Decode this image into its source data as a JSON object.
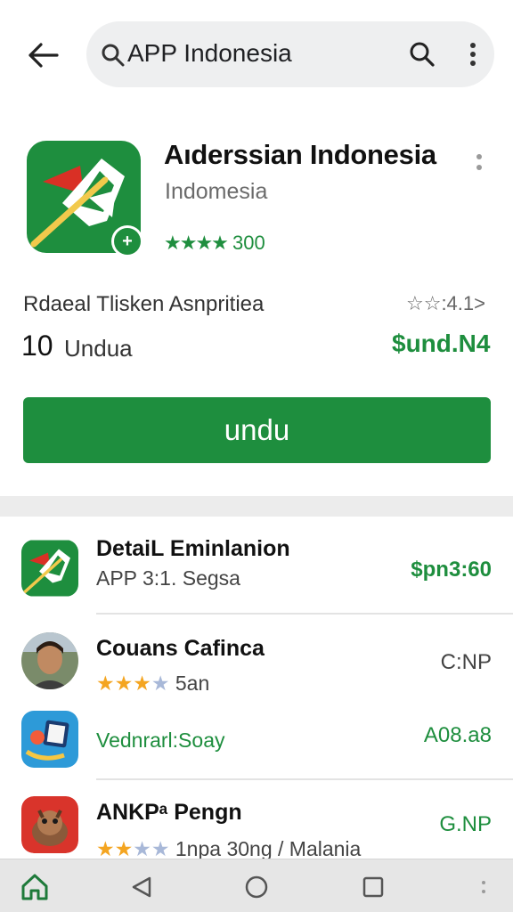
{
  "search": {
    "query": "APP Indonesia"
  },
  "app": {
    "title": "Aıderssian Indonesia",
    "developer": "Indomesia",
    "stars": "★★★★",
    "rating_text": "300",
    "meta_label": "Rdaeal Tlisken Asnpritiea",
    "meta_rating": "☆☆:4.1>",
    "count": "10",
    "count_label": "Undua",
    "price": "$und.N4",
    "install_label": "undu"
  },
  "list": [
    {
      "title": "DetaiL Eminlanion",
      "sub": "APP 3:1. Segsa",
      "right": "$pn3:60",
      "right_style": "green"
    },
    {
      "title": "Couans Cafinca",
      "stars_filled": "★★★",
      "stars_empty": "★",
      "sub": "5an",
      "right": "C:NP",
      "right_style": "gray"
    },
    {
      "title": "",
      "sub": "Vednrarl:Soay",
      "right": "A08.a8",
      "right_style": "green"
    },
    {
      "title": "ANKPᵃ Pengn",
      "stars_filled": "★★",
      "stars_empty": "★★",
      "sub": "1npa 30ng / Malania",
      "right": "G.NP",
      "right_style": "green"
    }
  ],
  "colors": {
    "accent": "#1e8e3e",
    "background": "#ffffff",
    "navbar": "#e6e6e6",
    "star_yellow": "#f4a521"
  },
  "icons": [
    "back-arrow-icon",
    "search-icon",
    "more-vert-icon",
    "home-icon",
    "back-triangle-icon",
    "circle-home-icon",
    "square-recents-icon"
  ]
}
